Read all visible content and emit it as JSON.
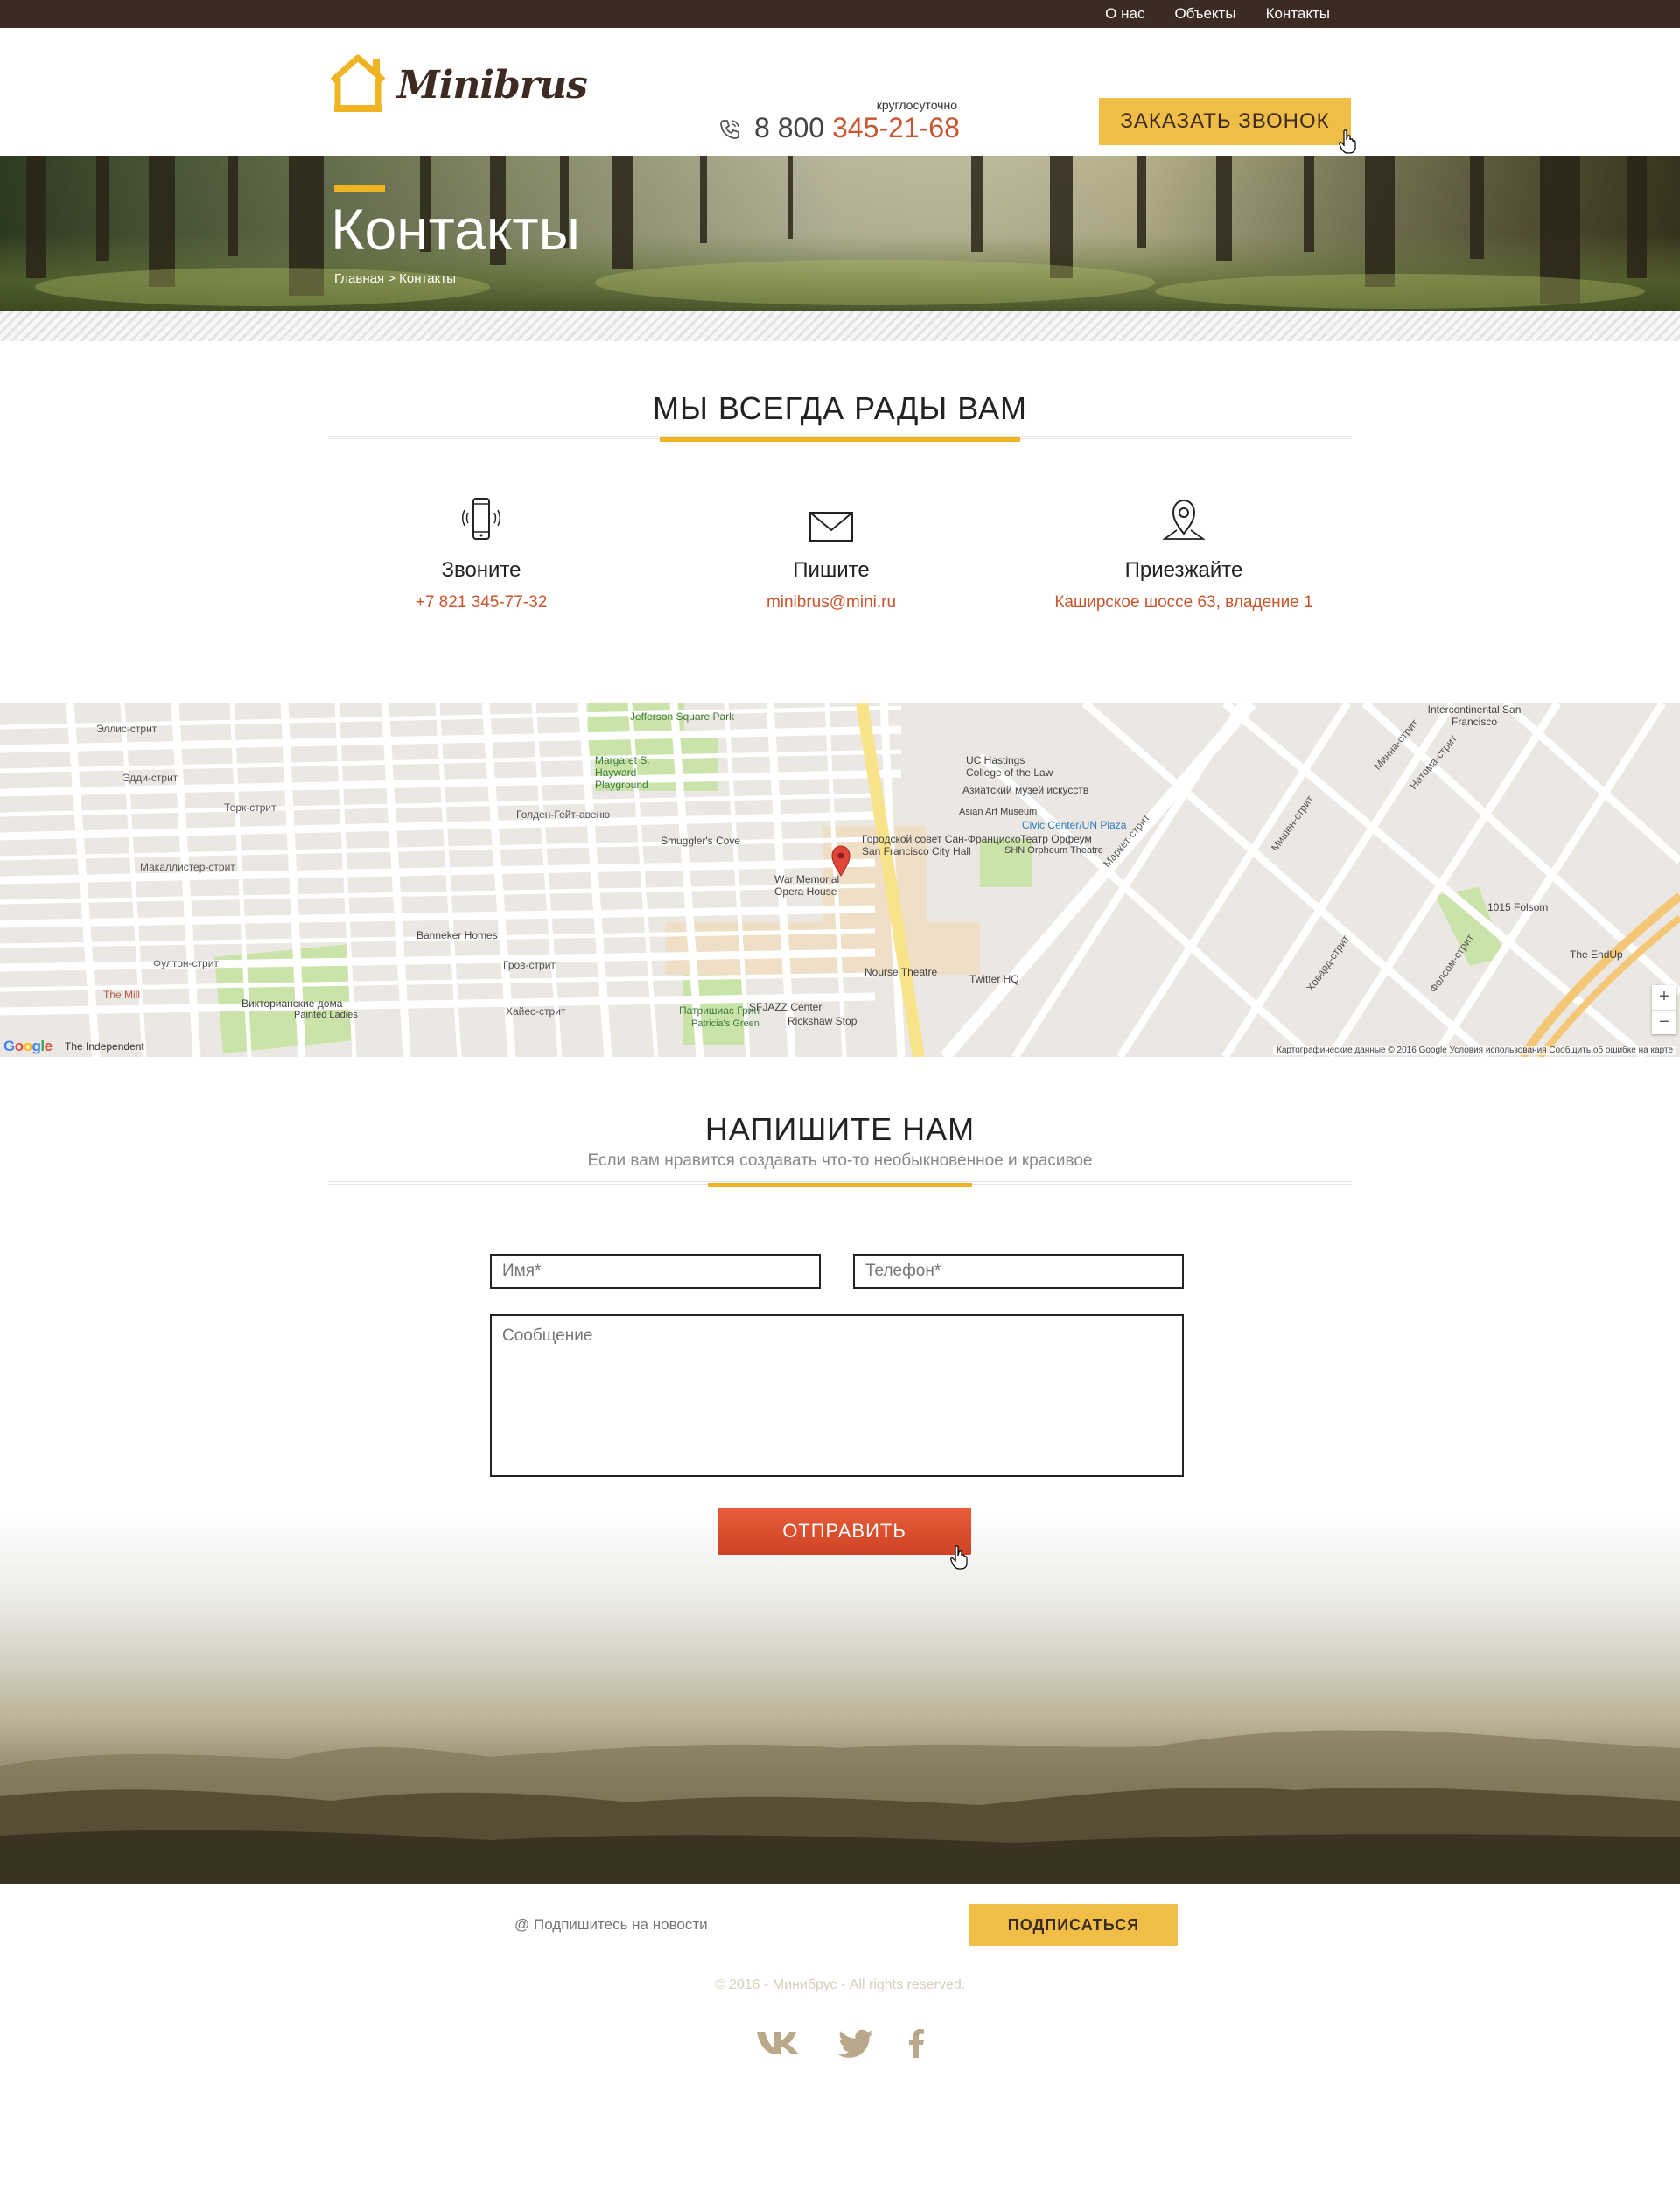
{
  "topnav": {
    "items": [
      "О нас",
      "Объекты",
      "Контакты"
    ]
  },
  "header": {
    "logo_text": "Minibrus",
    "phone_caption": "круглосуточно",
    "phone_prefix": "8 800",
    "phone_main": "345-21-68",
    "cta_label": "ЗАКАЗАТЬ ЗВОНОК"
  },
  "hero": {
    "title": "Контакты",
    "breadcrumb": "Главная > Контакты"
  },
  "welcome": {
    "title": "МЫ ВСЕГДА РАДЫ ВАМ"
  },
  "contacts": [
    {
      "icon": "mobile-phone-icon",
      "title": "Звоните",
      "value": "+7 821 345-77-32"
    },
    {
      "icon": "envelope-icon",
      "title": "Пишите",
      "value": "minibrus@mini.ru"
    },
    {
      "icon": "location-pin-icon",
      "title": "Приезжайте",
      "value": "Каширское шоссе 63, владение 1"
    }
  ],
  "map": {
    "labels": [
      "Эллис-стрит",
      "Эдди-стрит",
      "Терк-стрит",
      "Голден-Гейт-авеню",
      "Макаллистер-стрит",
      "Фултон-стрит",
      "Jefferson Square Park",
      "Margaret S. Hayward Playground",
      "Smuggler's Cove",
      "Banneker Homes",
      "Викторианские дома",
      "Painted Ladies",
      "The Mill",
      "Гров-стрит",
      "Хайес-стрит",
      "Городской совет Сан-Франциско",
      "San Francisco City Hall",
      "War Memorial Opera House",
      "UC Hastings College of the Law",
      "Азиатский музей искусств",
      "Asian Art Museum",
      "Civic Center/UN Plaza",
      "Театр Орфеум",
      "SHN Orpheum Theatre",
      "Nourse Theatre",
      "Twitter HQ",
      "SFJAZZ Center",
      "Rickshaw Stop",
      "Патришиас Грин",
      "Patricia's Green",
      "Intercontinental San Francisco",
      "1015 Folsom",
      "The EndUp",
      "Маркет-стрит",
      "Мишен-стрит",
      "Ховард-стрит",
      "Фолсом-стрит",
      "Натома-стрит",
      "Минна-стрит"
    ],
    "google": "Google",
    "independent": "The Independent",
    "attribution": "Картографические данные © 2016 Google   Условия использования   Сообщить об ошибке на карте",
    "zoom_in": "+",
    "zoom_out": "−"
  },
  "form": {
    "title": "НАПИШИТЕ НАМ",
    "subtitle": "Если вам нравится создавать что-то необыкновенное и красивое",
    "name_placeholder": "Имя*",
    "phone_placeholder": "Телефон*",
    "message_placeholder": "Сообщение",
    "submit_label": "ОТПРАВИТЬ"
  },
  "footer": {
    "subscribe_placeholder": "@ Подпишитесь на новости",
    "subscribe_label": "ПОДПИСАТЬСЯ",
    "copyright": "© 2016 - Минибрус - All rights reserved.",
    "social": [
      "vk-icon",
      "twitter-icon",
      "facebook-icon"
    ]
  },
  "colors": {
    "topbar": "#3b2b23",
    "accent_yellow": "#f0bd46",
    "accent_orange": "#c8552e",
    "submit_red": "#d94b2c"
  }
}
